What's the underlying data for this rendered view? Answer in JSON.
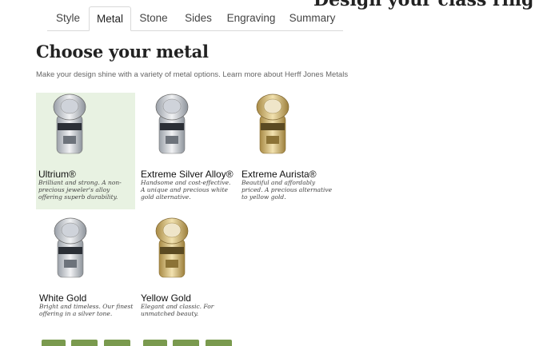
{
  "page": {
    "cropped_title": "Design your class ring",
    "heading": "Choose your metal",
    "subtitle_text": "Make your design shine with a variety of metal options.",
    "subtitle_link": "Learn more about Herff Jones Metals"
  },
  "tabs": [
    {
      "label": "Style"
    },
    {
      "label": "Metal",
      "active": true
    },
    {
      "label": "Stone"
    },
    {
      "label": "Sides"
    },
    {
      "label": "Engraving"
    },
    {
      "label": "Summary"
    }
  ],
  "metals": [
    {
      "name": "Ultrium®",
      "desc": "Brilliant and strong. A non-precious jeweler's alloy offering superb durability.",
      "tone": "silver",
      "selected": true
    },
    {
      "name": "Extreme Silver Alloy®",
      "desc": "Handsome and cost-effective. A unique and precious white gold alternative.",
      "tone": "silver"
    },
    {
      "name": "Extreme Aurista®",
      "desc": "Beautiful and affordably priced. A precious alternative to yellow gold.",
      "tone": "gold"
    },
    {
      "name": "White Gold",
      "desc": "Bright and timeless. Our finest offering in a silver tone.",
      "tone": "silver"
    },
    {
      "name": "Yellow Gold",
      "desc": "Elegant and classic. For unmatched beauty.",
      "tone": "gold"
    }
  ],
  "colors": {
    "selected_bg": "#e8f2e2",
    "accent_green": "#7a9a4e",
    "silver": "#c9ccd1",
    "gold": "#d4b467"
  }
}
